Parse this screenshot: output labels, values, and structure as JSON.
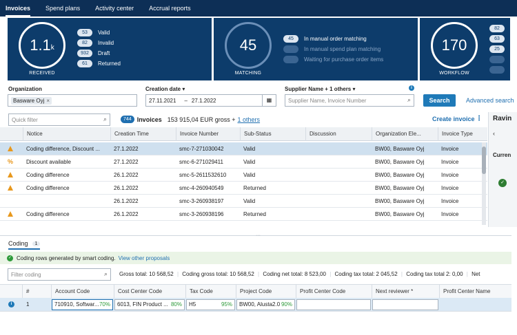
{
  "nav": {
    "tabs": [
      {
        "label": "Invoices"
      },
      {
        "label": "Spend plans"
      },
      {
        "label": "Activity center"
      },
      {
        "label": "Accrual reports"
      }
    ]
  },
  "dashboard": {
    "received": {
      "value": "1.1",
      "suffix": "k",
      "caption": "RECEIVED",
      "stats": [
        {
          "count": "53",
          "label": "Valid"
        },
        {
          "count": "82",
          "label": "Invalid"
        },
        {
          "count": "932",
          "label": "Draft"
        },
        {
          "count": "61",
          "label": "Returned"
        }
      ]
    },
    "matching": {
      "value": "45",
      "caption": "MATCHING",
      "stats": [
        {
          "count": "45",
          "label": "In manual order matching"
        },
        {
          "count": "0",
          "label": "In manual spend plan matching"
        },
        {
          "count": "0",
          "label": "Waiting for purchase order items"
        }
      ]
    },
    "workflow": {
      "value": "170",
      "caption": "WORKFLOW",
      "stats": [
        "82",
        "63",
        "25",
        "0",
        "0"
      ]
    }
  },
  "filters": {
    "organization_label": "Organization",
    "organization_chip": "Basware Oyj",
    "organization_chip_x": "×",
    "creation_date_label": "Creation date",
    "date_from": "27.11.2021",
    "date_sep": "–",
    "date_to": "27.1.2022",
    "supplier_label": "Supplier Name + 1 others",
    "supplier_placeholder": "Supplier Name, Invoice Number",
    "search_button": "Search",
    "advanced_search": "Advanced search"
  },
  "toolbar": {
    "quick_filter_placeholder": "Quick filter",
    "invoice_count": "744",
    "invoices_label": "Invoices",
    "totals": "153 915,04 EUR gross +",
    "others_link": "1 others",
    "create_invoice": "Create invoice",
    "right_panel_title": "Ravin",
    "right_panel_sub": "Curren"
  },
  "invoice_table": {
    "columns": [
      "Notice",
      "Creation Time",
      "Invoice Number",
      "Sub-Status",
      "Discussion",
      "Organization Ele...",
      "Invoice Type"
    ],
    "rows": [
      {
        "icon": "warn",
        "notice": "Coding difference, Discount ...",
        "time": "27.1.2022",
        "number": "smc-7-271030042",
        "status": "Valid",
        "discussion": "",
        "org": "BW00, Basware Oyj",
        "type": "Invoice",
        "selected": true
      },
      {
        "icon": "pct",
        "notice": "Discount available",
        "time": "27.1.2022",
        "number": "smc-6-271029411",
        "status": "Valid",
        "discussion": "",
        "org": "BW00, Basware Oyj",
        "type": "Invoice"
      },
      {
        "icon": "warn",
        "notice": "Coding difference",
        "time": "26.1.2022",
        "number": "smc-5-2611532610",
        "status": "Valid",
        "discussion": "",
        "org": "BW00, Basware Oyj",
        "type": "Invoice"
      },
      {
        "icon": "warn",
        "notice": "Coding difference",
        "time": "26.1.2022",
        "number": "smc-4-260940549",
        "status": "Returned",
        "discussion": "",
        "org": "BW00, Basware Oyj",
        "type": "Invoice"
      },
      {
        "icon": "",
        "notice": "",
        "time": "26.1.2022",
        "number": "smc-3-260938197",
        "status": "Valid",
        "discussion": "",
        "org": "BW00, Basware Oyj",
        "type": "Invoice"
      },
      {
        "icon": "warn",
        "notice": "Coding difference",
        "time": "26.1.2022",
        "number": "smc-3-260938196",
        "status": "Returned",
        "discussion": "",
        "org": "BW00, Basware Oyj",
        "type": "Invoice"
      }
    ]
  },
  "coding": {
    "tab_label": "Coding",
    "tab_count": "1",
    "smart_message": "Coding rows generated by smart coding.",
    "view_proposals": "View other proposals",
    "filter_placeholder": "Filter coding",
    "totals": [
      "Gross total: 10 568,52",
      "Coding gross total: 10 568,52",
      "Coding net total: 8 523,00",
      "Coding tax total: 2 045,52",
      "Coding tax total 2: 0,00",
      "Net"
    ],
    "columns": [
      "#",
      "Account Code",
      "Cost Center Code",
      "Tax Code",
      "Project Code",
      "Profit Center Code",
      "Next reviewer *",
      "Profit Center Name"
    ],
    "row": {
      "index": "1",
      "account": "710910, Softwar...",
      "account_conf": "70%",
      "cost_center": "6013, FIN Product ...",
      "cost_center_conf": "80%",
      "tax": "H5",
      "tax_conf": "95%",
      "project": "BW00, Alusta2.0",
      "project_conf": "90%"
    }
  }
}
